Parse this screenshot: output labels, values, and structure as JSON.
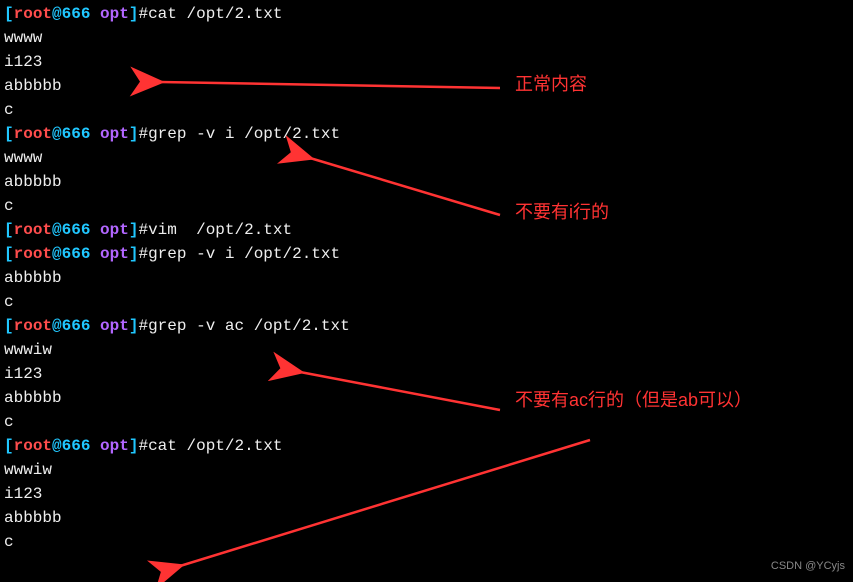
{
  "prompt": {
    "open": "[",
    "user": "root",
    "at": "@",
    "host": "666",
    "space": " ",
    "path": "opt",
    "close": "]",
    "hash": "#"
  },
  "blocks": [
    {
      "cmd": "cat /opt/2.txt",
      "output": [
        "wwww",
        "i123",
        "abbbbb",
        "c"
      ]
    },
    {
      "cmd": "grep -v i /opt/2.txt",
      "output": [
        "wwww",
        "abbbbb",
        "c"
      ]
    },
    {
      "cmd": "vim  /opt/2.txt",
      "output": []
    },
    {
      "cmd": "grep -v i /opt/2.txt",
      "output": [
        "abbbbb",
        "c"
      ]
    },
    {
      "cmd": "grep -v ac /opt/2.txt",
      "output": [
        "wwwiw",
        "i123",
        "abbbbb",
        "c"
      ]
    },
    {
      "cmd": "cat /opt/2.txt",
      "output": [
        "wwwiw",
        "i123",
        "abbbbb",
        "c"
      ]
    }
  ],
  "annotations": {
    "a1": "正常内容",
    "a2": "不要有i行的",
    "a3": "不要有ac行的（但是ab可以）"
  },
  "watermark": "CSDN @YCyjs"
}
